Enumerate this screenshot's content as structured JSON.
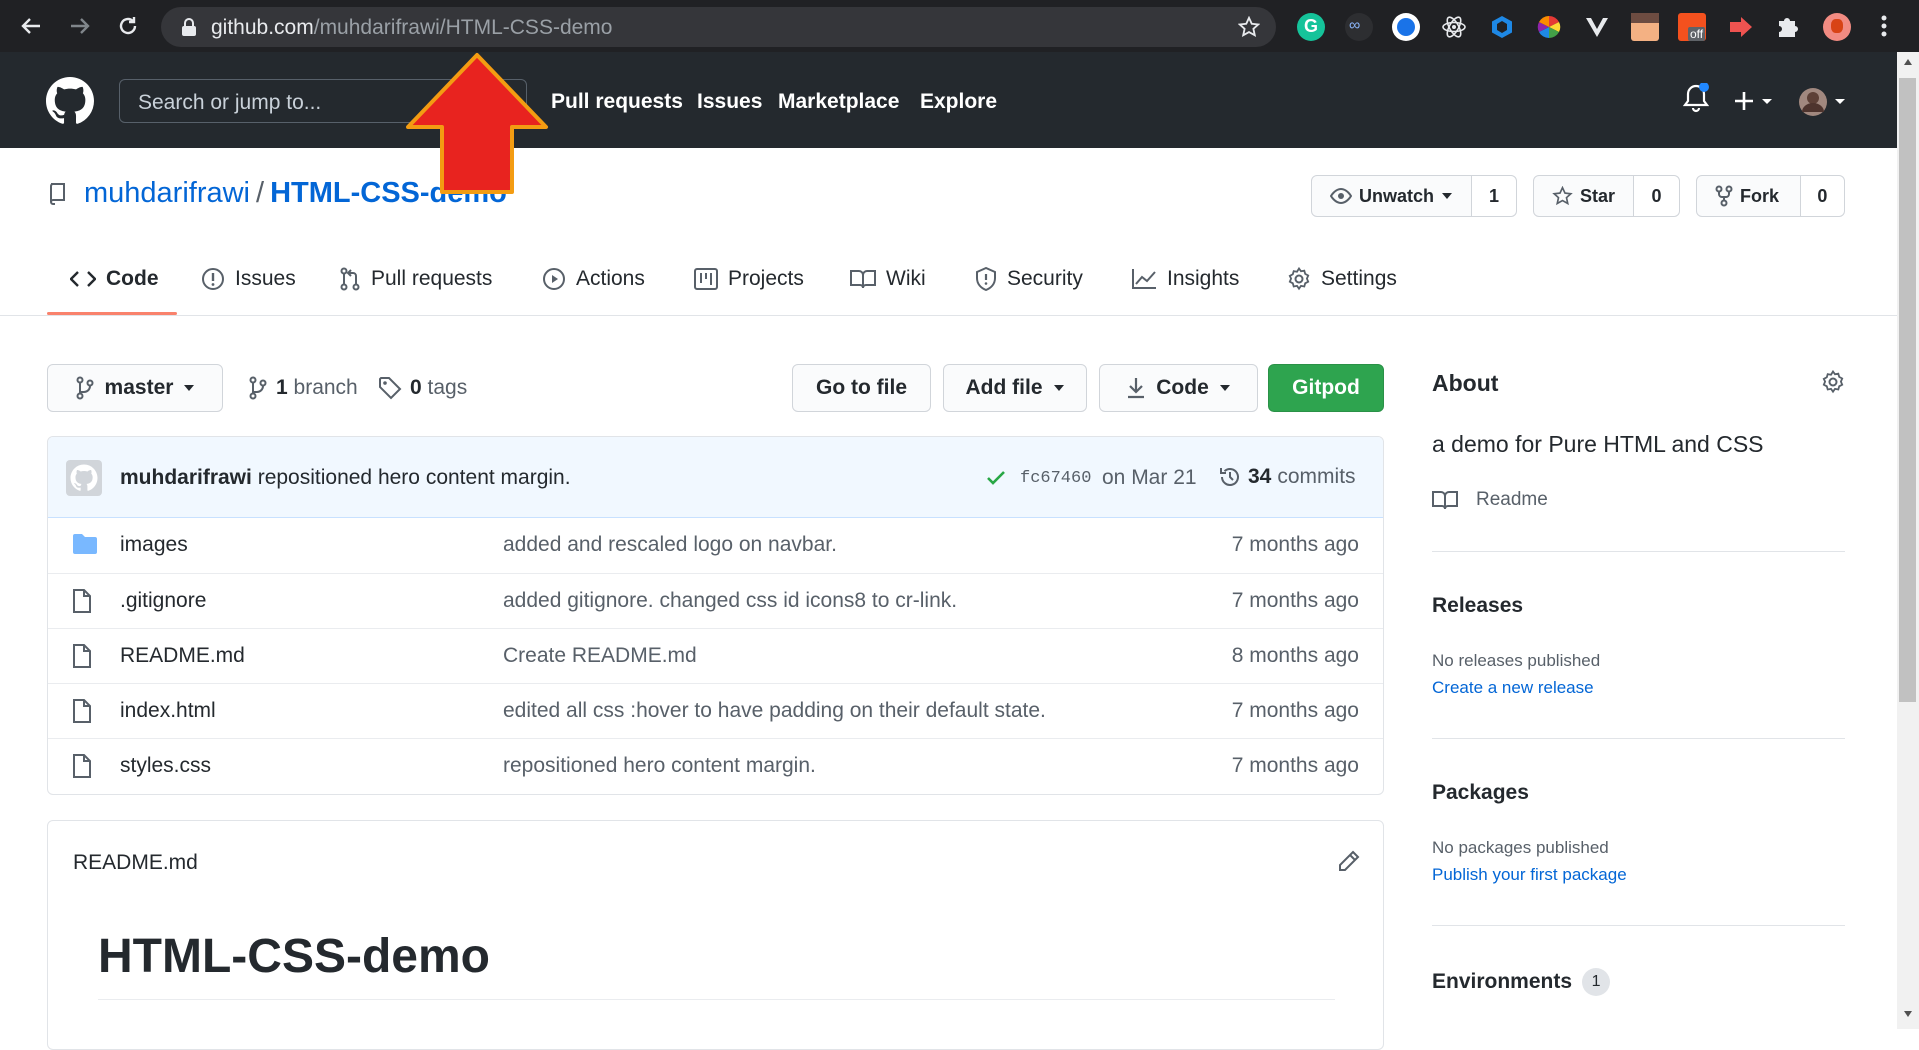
{
  "browser": {
    "url_host": "github.com",
    "url_path": "/muhdarifrawi/HTML-CSS-demo",
    "extension_badge": "off"
  },
  "header": {
    "search_placeholder": "Search or jump to...",
    "nav": [
      "Pull requests",
      "Issues",
      "Marketplace",
      "Explore"
    ]
  },
  "repo": {
    "owner": "muhdarifrawi",
    "separator": "/",
    "name": "HTML-CSS-demo",
    "watch_label": "Unwatch",
    "watch_count": "1",
    "star_label": "Star",
    "star_count": "0",
    "fork_label": "Fork",
    "fork_count": "0"
  },
  "tabs": [
    "Code",
    "Issues",
    "Pull requests",
    "Actions",
    "Projects",
    "Wiki",
    "Security",
    "Insights",
    "Settings"
  ],
  "toolbar": {
    "branch": "master",
    "branch_count": "1",
    "branch_word": "branch",
    "tag_count": "0",
    "tag_word": "tags",
    "go_to_file": "Go to file",
    "add_file": "Add file",
    "code": "Code",
    "gitpod": "Gitpod"
  },
  "commit": {
    "author": "muhdarifrawi",
    "message": "repositioned hero content margin.",
    "sha": "fc67460",
    "date": "on Mar 21",
    "count": "34",
    "count_word": "commits"
  },
  "files": [
    {
      "name": "images",
      "type": "dir",
      "message": "added and rescaled logo on navbar.",
      "age": "7 months ago"
    },
    {
      "name": ".gitignore",
      "type": "file",
      "message": "added gitignore. changed css id icons8 to cr-link.",
      "age": "7 months ago"
    },
    {
      "name": "README.md",
      "type": "file",
      "message": "Create README.md",
      "age": "8 months ago"
    },
    {
      "name": "index.html",
      "type": "file",
      "message": "edited all css :hover to have padding on their default state.",
      "age": "7 months ago"
    },
    {
      "name": "styles.css",
      "type": "file",
      "message": "repositioned hero content margin.",
      "age": "7 months ago"
    }
  ],
  "readme": {
    "filename": "README.md",
    "heading": "HTML-CSS-demo"
  },
  "sidebar": {
    "about_title": "About",
    "description": "a demo for Pure HTML and CSS",
    "readme_link": "Readme",
    "releases_title": "Releases",
    "releases_text": "No releases published",
    "releases_link": "Create a new release",
    "packages_title": "Packages",
    "packages_text": "No packages published",
    "packages_link": "Publish your first package",
    "environments_title": "Environments",
    "environments_count": "1"
  },
  "colors": {
    "header_bg": "#24292e",
    "link": "#0366d6",
    "gitpod_green": "#2ea44f",
    "tab_underline": "#f9826c",
    "annotation_arrow": "#e8231f"
  }
}
